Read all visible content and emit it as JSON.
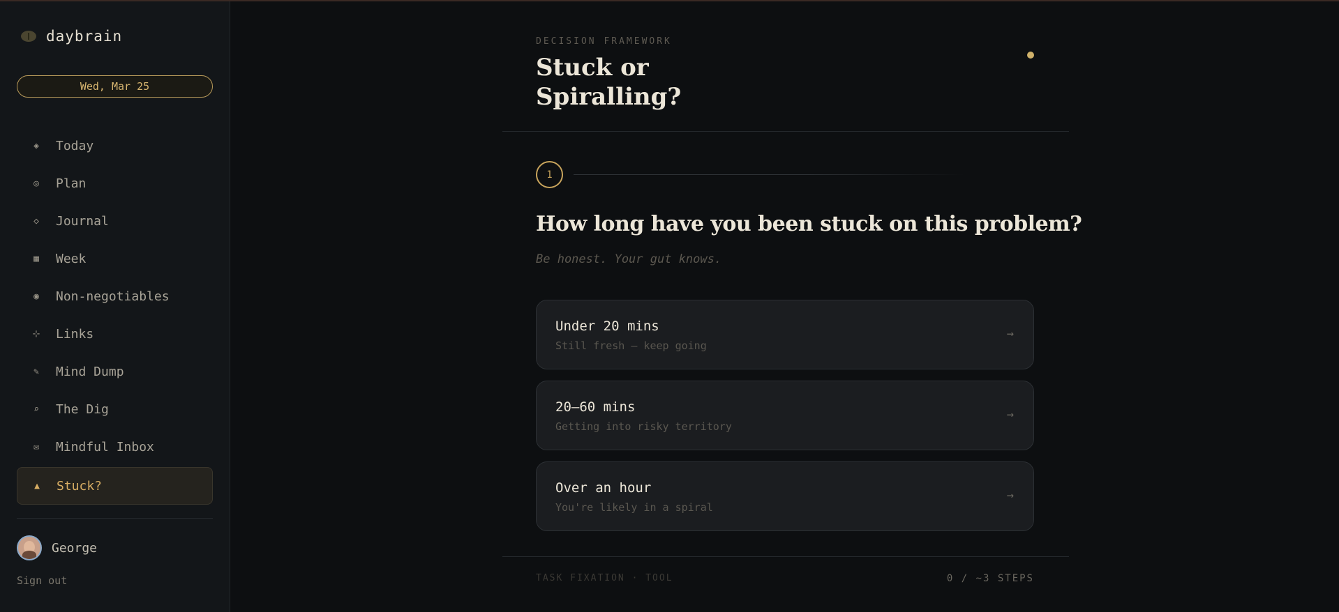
{
  "app": {
    "name": "daybrain",
    "date": "Wed, Mar 25"
  },
  "sidebar": {
    "items": [
      {
        "icon": "◈",
        "label": "Today"
      },
      {
        "icon": "◎",
        "label": "Plan"
      },
      {
        "icon": "◇",
        "label": "Journal"
      },
      {
        "icon": "▦",
        "label": "Week"
      },
      {
        "icon": "◉",
        "label": "Non-negotiables"
      },
      {
        "icon": "⊹",
        "label": "Links"
      },
      {
        "icon": "✎",
        "label": "Mind Dump"
      },
      {
        "icon": "⌕",
        "label": "The Dig"
      },
      {
        "icon": "✉",
        "label": "Mindful Inbox"
      },
      {
        "icon": "▲",
        "label": "Stuck?"
      }
    ],
    "active": "Stuck?",
    "user": {
      "name": "George"
    },
    "signout": "Sign out"
  },
  "main": {
    "eyebrow": "DECISION FRAMEWORK",
    "title": "Stuck or Spiralling?",
    "step": "1",
    "question": "How long have you been stuck on this problem?",
    "hint": "Be honest. Your gut knows.",
    "options": [
      {
        "label": "Under 20 mins",
        "sub": "Still fresh — keep going",
        "arrow": "→"
      },
      {
        "label": "20–60 mins",
        "sub": "Getting into risky territory",
        "arrow": "→"
      },
      {
        "label": "Over an hour",
        "sub": "You're likely in a spiral",
        "arrow": "→"
      }
    ],
    "footer_left": "TASK FIXATION · TOOL",
    "footer_right": "0 / ~3 STEPS"
  },
  "colors": {
    "accent": "#d8ae64",
    "background": "#0d0f11",
    "sidebar": "#131619"
  }
}
